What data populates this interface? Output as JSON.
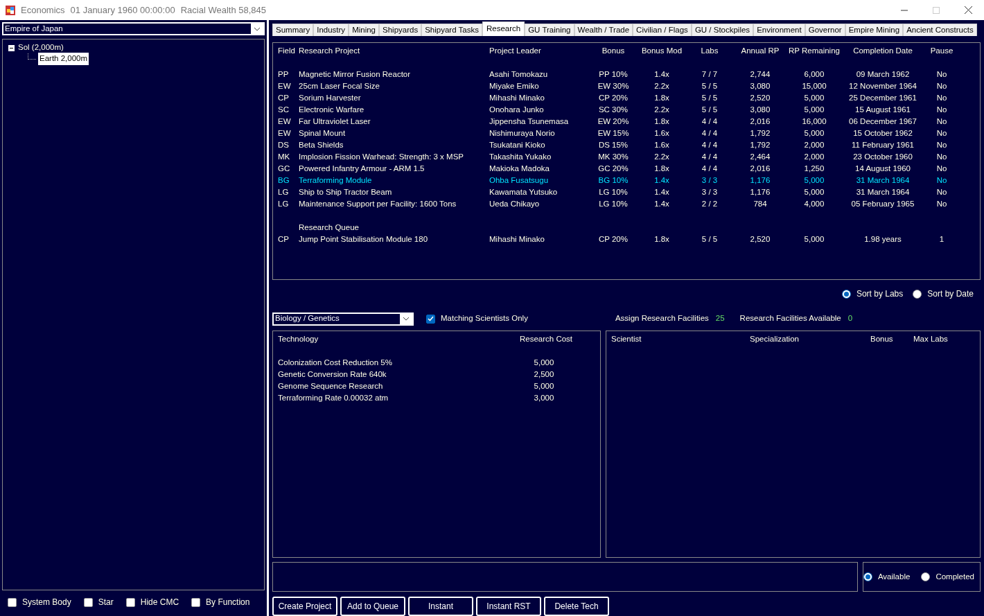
{
  "window": {
    "title_parts": [
      "Economics",
      "01 January 1960 00:00:00",
      "Racial Wealth 58,845"
    ]
  },
  "left": {
    "empire_select": "Empire of Japan",
    "tree": [
      {
        "label": "Sol  (2,000m)",
        "expanded": true,
        "selected": false,
        "children": [
          {
            "label": "Earth  2,000m",
            "selected": true
          }
        ]
      }
    ],
    "filters": [
      {
        "label": "System Body",
        "checked": false
      },
      {
        "label": "Star",
        "checked": false
      },
      {
        "label": "Hide CMC",
        "checked": false
      },
      {
        "label": "By Function",
        "checked": false
      }
    ]
  },
  "tabs": [
    {
      "label": "Summary",
      "selected": false
    },
    {
      "label": "Industry",
      "selected": false
    },
    {
      "label": "Mining",
      "selected": false
    },
    {
      "label": "Shipyards",
      "selected": false
    },
    {
      "label": "Shipyard Tasks",
      "selected": false
    },
    {
      "label": "Research",
      "selected": true
    },
    {
      "label": "GU Training",
      "selected": false
    },
    {
      "label": "Wealth / Trade",
      "selected": false
    },
    {
      "label": "Civilian / Flags",
      "selected": false
    },
    {
      "label": "GU / Stockpiles",
      "selected": false
    },
    {
      "label": "Environment",
      "selected": false
    },
    {
      "label": "Governor",
      "selected": false
    },
    {
      "label": "Empire Mining",
      "selected": false
    },
    {
      "label": "Ancient Constructs",
      "selected": false
    }
  ],
  "research": {
    "columns": [
      "Field",
      "Research Project",
      "Project Leader",
      "Bonus",
      "Bonus Mod",
      "Labs",
      "Annual RP",
      "RP Remaining",
      "Completion Date",
      "Pause"
    ],
    "projects": [
      {
        "cells": [
          "PP",
          "Magnetic Mirror Fusion Reactor",
          "Asahi Tomokazu",
          "PP 10%",
          "1.4x",
          "7 / 7",
          "2,744",
          "6,000",
          "09 March 1962",
          "No"
        ],
        "selected": false
      },
      {
        "cells": [
          "EW",
          "25cm Laser Focal Size",
          "Miyake Emiko",
          "EW 30%",
          "2.2x",
          "5 / 5",
          "3,080",
          "15,000",
          "12 November 1964",
          "No"
        ],
        "selected": false
      },
      {
        "cells": [
          "CP",
          "Sorium Harvester",
          "Mihashi Minako",
          "CP 20%",
          "1.8x",
          "5 / 5",
          "2,520",
          "5,000",
          "25 December 1961",
          "No"
        ],
        "selected": false
      },
      {
        "cells": [
          "SC",
          "Electronic Warfare",
          "Onohara Junko",
          "SC 30%",
          "2.2x",
          "5 / 5",
          "3,080",
          "5,000",
          "15 August 1961",
          "No"
        ],
        "selected": false
      },
      {
        "cells": [
          "EW",
          "Far Ultraviolet Laser",
          "Jippensha Tsunemasa",
          "EW 20%",
          "1.8x",
          "4 / 4",
          "2,016",
          "16,000",
          "06 December 1967",
          "No"
        ],
        "selected": false
      },
      {
        "cells": [
          "EW",
          "Spinal Mount",
          "Nishimuraya Norio",
          "EW 15%",
          "1.6x",
          "4 / 4",
          "1,792",
          "5,000",
          "15 October 1962",
          "No"
        ],
        "selected": false
      },
      {
        "cells": [
          "DS",
          "Beta Shields",
          "Tsukatani Kioko",
          "DS 15%",
          "1.6x",
          "4 / 4",
          "1,792",
          "2,000",
          "11 February 1961",
          "No"
        ],
        "selected": false
      },
      {
        "cells": [
          "MK",
          "Implosion Fission Warhead: Strength: 3 x MSP",
          "Takashita Yukako",
          "MK 30%",
          "2.2x",
          "4 / 4",
          "2,464",
          "2,000",
          "23 October 1960",
          "No"
        ],
        "selected": false
      },
      {
        "cells": [
          "GC",
          "Powered Infantry Armour - ARM 1.5",
          "Makioka Madoka",
          "GC 20%",
          "1.8x",
          "4 / 4",
          "2,016",
          "1,250",
          "14 August 1960",
          "No"
        ],
        "selected": false
      },
      {
        "cells": [
          "BG",
          "Terraforming Module",
          "Ohba Fusatsugu",
          "BG 10%",
          "1.4x",
          "3 / 3",
          "1,176",
          "5,000",
          "31 March 1964",
          "No"
        ],
        "selected": true
      },
      {
        "cells": [
          "LG",
          "Ship to Ship Tractor Beam",
          "Kawamata Yutsuko",
          "LG 10%",
          "1.4x",
          "3 / 3",
          "1,176",
          "5,000",
          "31 March 1964",
          "No"
        ],
        "selected": false
      },
      {
        "cells": [
          "LG",
          "Maintenance Support per Facility: 1600 Tons",
          "Ueda Chikayo",
          "LG 10%",
          "1.4x",
          "2 / 2",
          "784",
          "4,000",
          "05 February 1965",
          "No"
        ],
        "selected": false
      }
    ],
    "queue_label": "Research Queue",
    "queue": [
      {
        "cells": [
          "CP",
          "Jump Point Stabilisation Module 180",
          "Mihashi Minako",
          "CP 20%",
          "1.8x",
          "5 / 5",
          "2,520",
          "5,000",
          "1.98 years",
          "1"
        ],
        "selected": false
      }
    ]
  },
  "sort_options": [
    {
      "label": "Sort by Labs",
      "selected": true
    },
    {
      "label": "Sort by Date",
      "selected": false
    }
  ],
  "field_select": "Biology / Genetics",
  "matching_scientists": {
    "label": "Matching Scientists Only",
    "checked": true
  },
  "facilities": [
    {
      "label": "Assign Research Facilities",
      "value": "25"
    },
    {
      "label": "Research Facilities Available",
      "value": "0"
    }
  ],
  "technologies": {
    "columns": [
      "Technology",
      "Research Cost"
    ],
    "rows": [
      {
        "name": "Colonization Cost Reduction 5%",
        "cost": "5,000"
      },
      {
        "name": "Genetic Conversion Rate 640k",
        "cost": "2,500"
      },
      {
        "name": "Genome Sequence Research",
        "cost": "5,000"
      },
      {
        "name": "Terraforming Rate 0.00032 atm",
        "cost": "3,000"
      }
    ]
  },
  "scientists": {
    "columns": [
      "Scientist",
      "Specialization",
      "Bonus",
      "Max Labs"
    ]
  },
  "view_options": [
    {
      "label": "Available",
      "selected": true
    },
    {
      "label": "Completed",
      "selected": false
    }
  ],
  "buttons": [
    "Create Project",
    "Add to Queue",
    "Instant",
    "Instant RST",
    "Delete Tech"
  ]
}
